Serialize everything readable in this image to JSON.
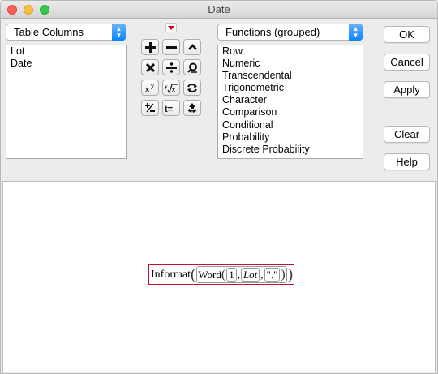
{
  "window": {
    "title": "Date"
  },
  "left_panel": {
    "popup_label": "Table Columns",
    "columns": [
      "Lot",
      "Date"
    ]
  },
  "operators": {
    "rows": [
      [
        {
          "name": "plus-icon",
          "glyph": "+"
        },
        {
          "name": "minus-icon",
          "glyph": "−"
        },
        {
          "name": "caret-up-icon",
          "glyph": "^"
        }
      ],
      [
        {
          "name": "multiply-icon",
          "glyph": "×"
        },
        {
          "name": "divide-icon",
          "glyph": "÷"
        },
        {
          "name": "search-icon",
          "glyph": "⚲"
        }
      ],
      [
        {
          "name": "power-icon",
          "glyph": "x^y"
        },
        {
          "name": "root-icon",
          "glyph": "y√x"
        },
        {
          "name": "swap-icon",
          "glyph": "⇄"
        }
      ],
      [
        {
          "name": "plus-minus-icon",
          "glyph": "±"
        },
        {
          "name": "assign-icon",
          "glyph": "t="
        },
        {
          "name": "recycle-icon",
          "glyph": "♻"
        }
      ]
    ]
  },
  "functions_panel": {
    "popup_label": "Functions (grouped)",
    "items": [
      "Row",
      "Numeric",
      "Transcendental",
      "Trigonometric",
      "Character",
      "Comparison",
      "Conditional",
      "Probability",
      "Discrete Probability"
    ]
  },
  "buttons": {
    "ok": "OK",
    "cancel": "Cancel",
    "apply": "Apply",
    "clear": "Clear",
    "help": "Help"
  },
  "formula": {
    "outer_function": "Informat",
    "inner_function": "Word",
    "arg1": "1",
    "arg2": "Lot",
    "arg3": "\".\"",
    "separator": ","
  },
  "colors": {
    "accent": "#0a84ff",
    "formula_border": "#c8102e",
    "dropmark": "#d0021b"
  }
}
